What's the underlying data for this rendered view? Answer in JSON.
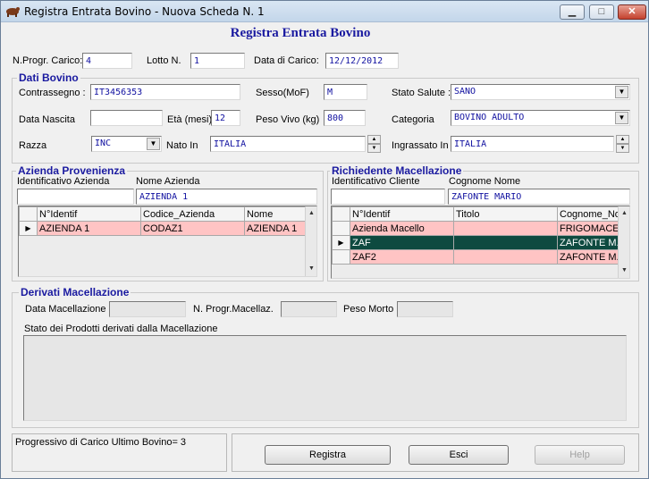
{
  "window": {
    "title": "Registra Entrata Bovino - Nuova Scheda N. 1",
    "min_glyph": "▁",
    "max_glyph": "□",
    "close_glyph": "✕"
  },
  "page_title": "Registra Entrata Bovino",
  "header": {
    "nprog_label": "N.Progr. Carico:",
    "nprog_value": "4",
    "lotto_label": "Lotto N.",
    "lotto_value": "1",
    "data_carico_label": "Data di Carico:",
    "data_carico_value": "12/12/2012"
  },
  "dati_bovino": {
    "title": "Dati Bovino",
    "contrassegno_label": "Contrassegno :",
    "contrassegno_value": "IT3456353",
    "sesso_label": "Sesso(MoF)",
    "sesso_value": "M",
    "stato_salute_label": "Stato Salute :",
    "stato_salute_value": "SANO",
    "data_nascita_label": "Data Nascita",
    "data_nascita_value": "",
    "eta_label": "Età (mesi)",
    "eta_value": "12",
    "peso_vivo_label": "Peso Vivo (kg)",
    "peso_vivo_value": "800",
    "categoria_label": "Categoria",
    "categoria_value": "BOVINO ADULTO",
    "razza_label": "Razza",
    "razza_value": "INC",
    "nato_in_label": "Nato In",
    "nato_in_value": "ITALIA",
    "ingrassato_label": "Ingrassato In",
    "ingrassato_value": "ITALIA"
  },
  "azienda": {
    "title": "Azienda Provenienza",
    "id_label": "Identificativo Azienda",
    "id_value": "",
    "nome_label": "Nome Azienda",
    "nome_value": "AZIENDA 1",
    "columns": [
      "N°Identif",
      "Codice_Azienda",
      "Nome"
    ],
    "rows": [
      [
        "AZIENDA 1",
        "CODAZ1",
        "AZIENDA 1"
      ]
    ]
  },
  "richiedente": {
    "title": "Richiedente Macellazione",
    "id_label": "Identificativo Cliente",
    "id_value": "",
    "nome_label": "Cognome Nome",
    "nome_value": "ZAFONTE MARIO",
    "columns": [
      "N°Identif",
      "Titolo",
      "Cognome_No"
    ],
    "rows": [
      [
        "Azienda Macello",
        "",
        "FRIGOMACE"
      ],
      [
        "ZAF",
        "",
        "ZAFONTE M."
      ],
      [
        "ZAF2",
        "",
        "ZAFONTE M."
      ]
    ]
  },
  "derivati": {
    "title": "Derivati Macellazione",
    "data_label": "Data Macellazione",
    "nprog_label": "N. Progr.Macellaz.",
    "peso_label": "Peso Morto",
    "stato_label": "Stato dei Prodotti derivati dalla  Macellazione"
  },
  "footer": {
    "status_text": "Progressivo di Carico Ultimo Bovino= 3",
    "registra_label": "Registra",
    "esci_label": "Esci",
    "help_label": "Help"
  },
  "icons": {
    "row_indicator": "▶",
    "dropdown": "▼",
    "up": "▲",
    "down": "▼"
  }
}
